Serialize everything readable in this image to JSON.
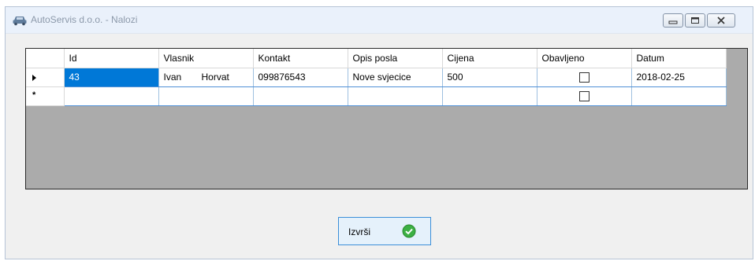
{
  "window": {
    "title": "AutoServis d.o.o. - Nalozi",
    "icons": {
      "app": "car-icon",
      "minimize": "minimize-icon",
      "maximize": "maximize-icon",
      "close": "close-icon"
    }
  },
  "grid": {
    "columns": [
      "Id",
      "Vlasnik",
      "Kontakt",
      "Opis posla",
      "Cijena",
      "Obavljeno",
      "Datum"
    ],
    "rows": [
      {
        "id": "43",
        "owner_first": "Ivan",
        "owner_last": "Horvat",
        "contact": "099876543",
        "description": "Nove svjecice",
        "price": "500",
        "done": false,
        "date": "2018-02-25"
      }
    ],
    "current_row_marker": "▶",
    "new_row_marker": "*",
    "selected_color": "#0078d7"
  },
  "execute_button": {
    "label": "Izvrši",
    "icon": "checkmark-circle-icon",
    "icon_color": "#3cb043"
  }
}
